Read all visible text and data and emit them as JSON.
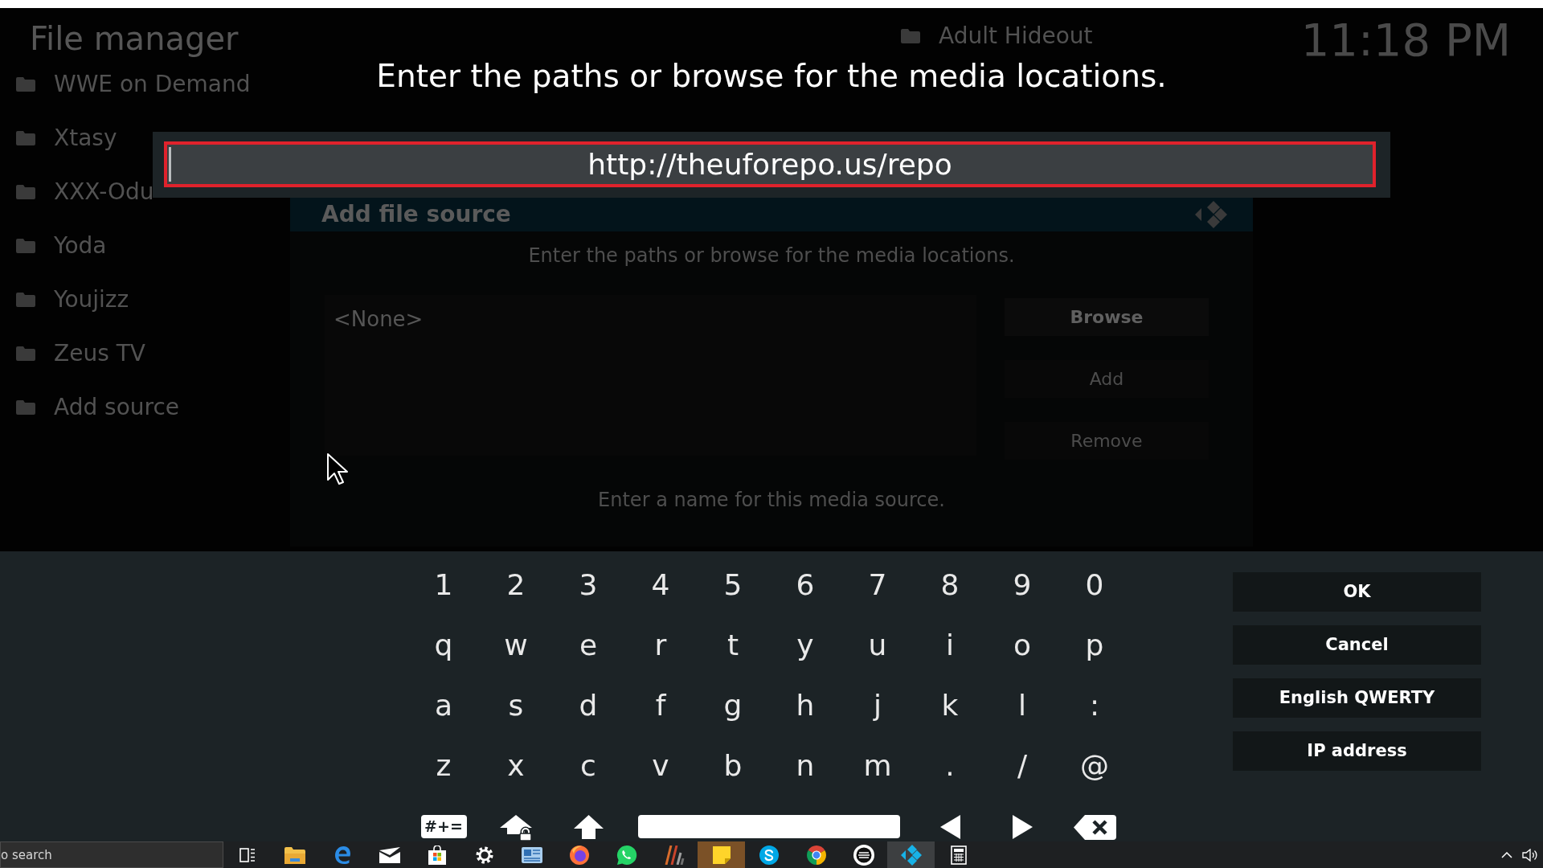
{
  "background": {
    "title": "File manager",
    "sources": [
      "WWE on Demand",
      "Xtasy",
      "XXX-Odu",
      "Yoda",
      "Youjizz",
      "Zeus TV",
      "Add source"
    ],
    "right_sources": [
      "Adult Hideout"
    ],
    "clock": "11:18 PM"
  },
  "dialog": {
    "title": "Add file source",
    "prompt": "Enter the paths or browse for the media locations.",
    "paths": [
      "<None>"
    ],
    "buttons": [
      {
        "label": "Browse",
        "focused": true
      },
      {
        "label": "Add",
        "focused": false
      },
      {
        "label": "Remove",
        "focused": false
      }
    ],
    "name_prompt": "Enter a name for this media source."
  },
  "keyboard": {
    "heading": "Enter the paths or browse for the media locations.",
    "value": "http://theuforepo.us/repo",
    "rows": [
      [
        "1",
        "2",
        "3",
        "4",
        "5",
        "6",
        "7",
        "8",
        "9",
        "0"
      ],
      [
        "q",
        "w",
        "e",
        "r",
        "t",
        "y",
        "u",
        "i",
        "o",
        "p"
      ],
      [
        "a",
        "s",
        "d",
        "f",
        "g",
        "h",
        "j",
        "k",
        "l",
        ":"
      ],
      [
        "z",
        "x",
        "c",
        "v",
        "b",
        "n",
        "m",
        ".",
        "/",
        "@"
      ]
    ],
    "bottom_keys": [
      {
        "kind": "symbols",
        "label": "#+="
      },
      {
        "kind": "caps_lock"
      },
      {
        "kind": "shift"
      },
      {
        "kind": "space"
      },
      {
        "kind": "left"
      },
      {
        "kind": "right"
      },
      {
        "kind": "backspace"
      }
    ],
    "actions": [
      "OK",
      "Cancel",
      "English QWERTY",
      "IP address"
    ]
  },
  "taskbar": {
    "search": {
      "placeholder": "o search"
    },
    "apps": [
      {
        "kind": "task_view",
        "active": false,
        "flashing": false
      },
      {
        "kind": "folder",
        "active": false,
        "flashing": false
      },
      {
        "kind": "letter_e",
        "active": false,
        "flashing": false
      },
      {
        "kind": "envelope",
        "active": false,
        "flashing": false
      },
      {
        "kind": "bag",
        "active": false,
        "flashing": false
      },
      {
        "kind": "gear",
        "active": false,
        "flashing": false
      },
      {
        "kind": "card",
        "active": false,
        "flashing": false
      },
      {
        "kind": "fox_globe",
        "active": false,
        "flashing": false
      },
      {
        "kind": "chat_bubble",
        "active": false,
        "flashing": false
      },
      {
        "kind": "stripes",
        "active": false,
        "flashing": false
      },
      {
        "kind": "sticky_note",
        "active": false,
        "flashing": true
      },
      {
        "kind": "letter_s",
        "active": false,
        "flashing": false
      },
      {
        "kind": "ring_logo",
        "active": false,
        "flashing": false
      },
      {
        "kind": "round_logo",
        "active": false,
        "flashing": false
      },
      {
        "kind": "diamond_logo",
        "active": true,
        "flashing": false
      },
      {
        "kind": "calculator",
        "active": false,
        "flashing": false
      }
    ],
    "tray": [
      {
        "kind": "chevron"
      },
      {
        "kind": "volume"
      }
    ]
  }
}
